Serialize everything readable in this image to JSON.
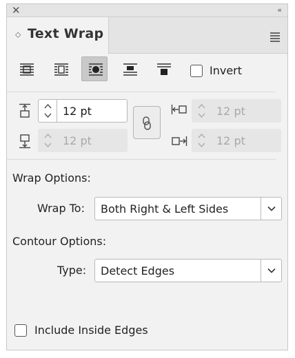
{
  "panel": {
    "tab_title": "Text Wrap"
  },
  "wrap_modes": [
    {
      "name": "No Text Wrap",
      "icon": "wrap-none-icon",
      "selected": false
    },
    {
      "name": "Wrap Around Bounding Box",
      "icon": "wrap-bounding-box-icon",
      "selected": false
    },
    {
      "name": "Wrap Around Object Shape",
      "icon": "wrap-object-shape-icon",
      "selected": true
    },
    {
      "name": "Jump Object",
      "icon": "wrap-jump-object-icon",
      "selected": false
    },
    {
      "name": "Jump to Next Column",
      "icon": "wrap-next-column-icon",
      "selected": false
    }
  ],
  "invert": {
    "label": "Invert",
    "checked": false
  },
  "offsets": {
    "top": {
      "value": "12 pt",
      "enabled": true
    },
    "bottom": {
      "value": "12 pt",
      "enabled": false
    },
    "left": {
      "value": "12 pt",
      "enabled": false
    },
    "right": {
      "value": "12 pt",
      "enabled": false
    },
    "make_all_settings_same": true
  },
  "wrap_options": {
    "heading": "Wrap Options:",
    "wrap_to_label": "Wrap To:",
    "wrap_to_value": "Both Right & Left Sides"
  },
  "contour_options": {
    "heading": "Contour Options:",
    "type_label": "Type:",
    "type_value": "Detect Edges"
  },
  "include_inside_edges": {
    "label": "Include Inside Edges",
    "checked": false
  }
}
